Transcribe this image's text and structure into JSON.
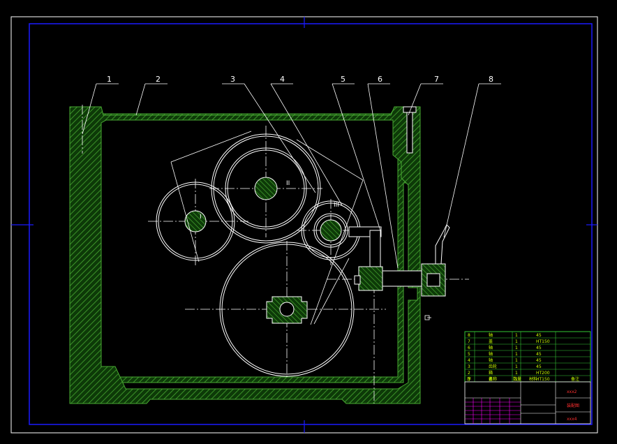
{
  "colors": {
    "background": "#000000",
    "frame": "#1a1aff",
    "lines": "#ffffff",
    "hatch": "#2e7d1e",
    "hatch_stroke": "#48a832",
    "table_lines": "#34c634",
    "table_text": "#c8ff00",
    "magenta": "#ff00ff",
    "red_text": "#ff3030"
  },
  "callouts": [
    "1",
    "2",
    "3",
    "4",
    "5",
    "6",
    "7",
    "8"
  ],
  "shaft_labels": [
    "I",
    "II",
    "III"
  ],
  "parts_table": {
    "rows": [
      {
        "no": "8",
        "name": "轴",
        "qty": "1",
        "material": "45"
      },
      {
        "no": "7",
        "name": "盖",
        "qty": "1",
        "material": "HT150"
      },
      {
        "no": "6",
        "name": "轴",
        "qty": "1",
        "material": "45"
      },
      {
        "no": "5",
        "name": "轴",
        "qty": "1",
        "material": "45"
      },
      {
        "no": "4",
        "name": "轴",
        "qty": "1",
        "material": "45"
      },
      {
        "no": "3",
        "name": "齿轮",
        "qty": "1",
        "material": "45"
      },
      {
        "no": "2",
        "name": "箱",
        "qty": "1",
        "material": "HT200"
      },
      {
        "no": "1",
        "name": "盖",
        "qty": "1",
        "material": "HT150"
      }
    ],
    "header": {
      "no": "序",
      "name": "名称",
      "qty": "数量",
      "material": "材料",
      "note": "备注"
    }
  },
  "title_block": {
    "code_top": "xxx2",
    "drawing_name": "装配图",
    "code_bottom": "xxx4"
  }
}
